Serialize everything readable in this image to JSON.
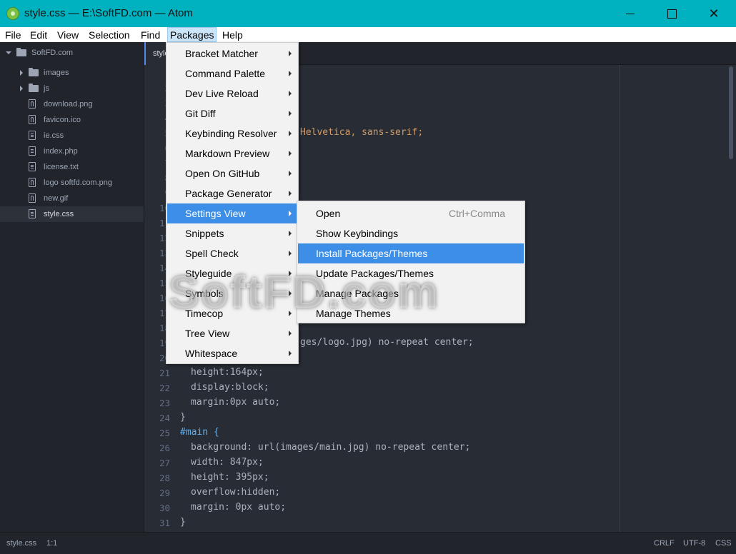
{
  "window": {
    "title": "style.css — E:\\SoftFD.com — Atom",
    "accent_color": "#00b2bf",
    "controls": {
      "minimize": "minimize-icon",
      "maximize": "maximize-icon",
      "close": "close-icon"
    },
    "close_glyph": "✕"
  },
  "menubar": {
    "items": [
      "File",
      "Edit",
      "View",
      "Selection",
      "Find",
      "Packages",
      "Help"
    ],
    "active": "Packages"
  },
  "tree": {
    "root": "SoftFD.com",
    "items": [
      {
        "name": "images",
        "type": "folder"
      },
      {
        "name": "js",
        "type": "folder"
      },
      {
        "name": "download.png",
        "type": "image"
      },
      {
        "name": "favicon.ico",
        "type": "image"
      },
      {
        "name": "ie.css",
        "type": "file"
      },
      {
        "name": "index.php",
        "type": "file"
      },
      {
        "name": "license.txt",
        "type": "file"
      },
      {
        "name": "logo softfd.com.png",
        "type": "image"
      },
      {
        "name": "new.gif",
        "type": "image"
      },
      {
        "name": "style.css",
        "type": "file",
        "selected": true
      }
    ]
  },
  "editor": {
    "tab_label": "style.css",
    "gutter_lines": [
      "1",
      "2",
      "3",
      "4",
      "5",
      "6",
      "7",
      "8",
      "9",
      "10",
      "11",
      "12",
      "13",
      "14",
      "15",
      "16",
      "17",
      "18",
      "19",
      "20",
      "21",
      "22",
      "23",
      "24",
      "25",
      "26",
      "27",
      "28",
      "29",
      "30",
      "31"
    ],
    "visible_code": {
      "line5": "Helvetica, sans-serif;",
      "line19": "ges/logo.jpg) no-repeat center;",
      "line21": "height:164px;",
      "line22": "display:block;",
      "line23": "margin:0px auto;",
      "line24": "}",
      "line25": "#main {",
      "line26": "background: url(images/main.jpg) no-repeat center;",
      "line27": "width: 847px;",
      "line28": "height: 395px;",
      "line29": "overflow:hidden;",
      "line30": "margin: 0px auto;",
      "line31": "}"
    }
  },
  "packages_menu": {
    "items": [
      "Bracket Matcher",
      "Command Palette",
      "Dev Live Reload",
      "Git Diff",
      "Keybinding Resolver",
      "Markdown Preview",
      "Open On GitHub",
      "Package Generator",
      "Settings View",
      "Snippets",
      "Spell Check",
      "Styleguide",
      "Symbols",
      "Timecop",
      "Tree View",
      "Whitespace"
    ],
    "highlighted": "Settings View"
  },
  "settings_submenu": {
    "items": [
      {
        "label": "Open",
        "shortcut": "Ctrl+Comma"
      },
      {
        "label": "Show Keybindings",
        "shortcut": ""
      },
      {
        "label": "Install Packages/Themes",
        "shortcut": ""
      },
      {
        "label": "Update Packages/Themes",
        "shortcut": ""
      },
      {
        "label": "Manage Packages",
        "shortcut": ""
      },
      {
        "label": "Manage Themes",
        "shortcut": ""
      }
    ],
    "highlighted": "Install Packages/Themes",
    "highlight_color": "#3d8ee6"
  },
  "statusbar": {
    "file": "style.css",
    "cursor": "1:1",
    "line_ending": "CRLF",
    "encoding": "UTF-8",
    "grammar": "CSS"
  },
  "watermark": "SoftFD.com"
}
